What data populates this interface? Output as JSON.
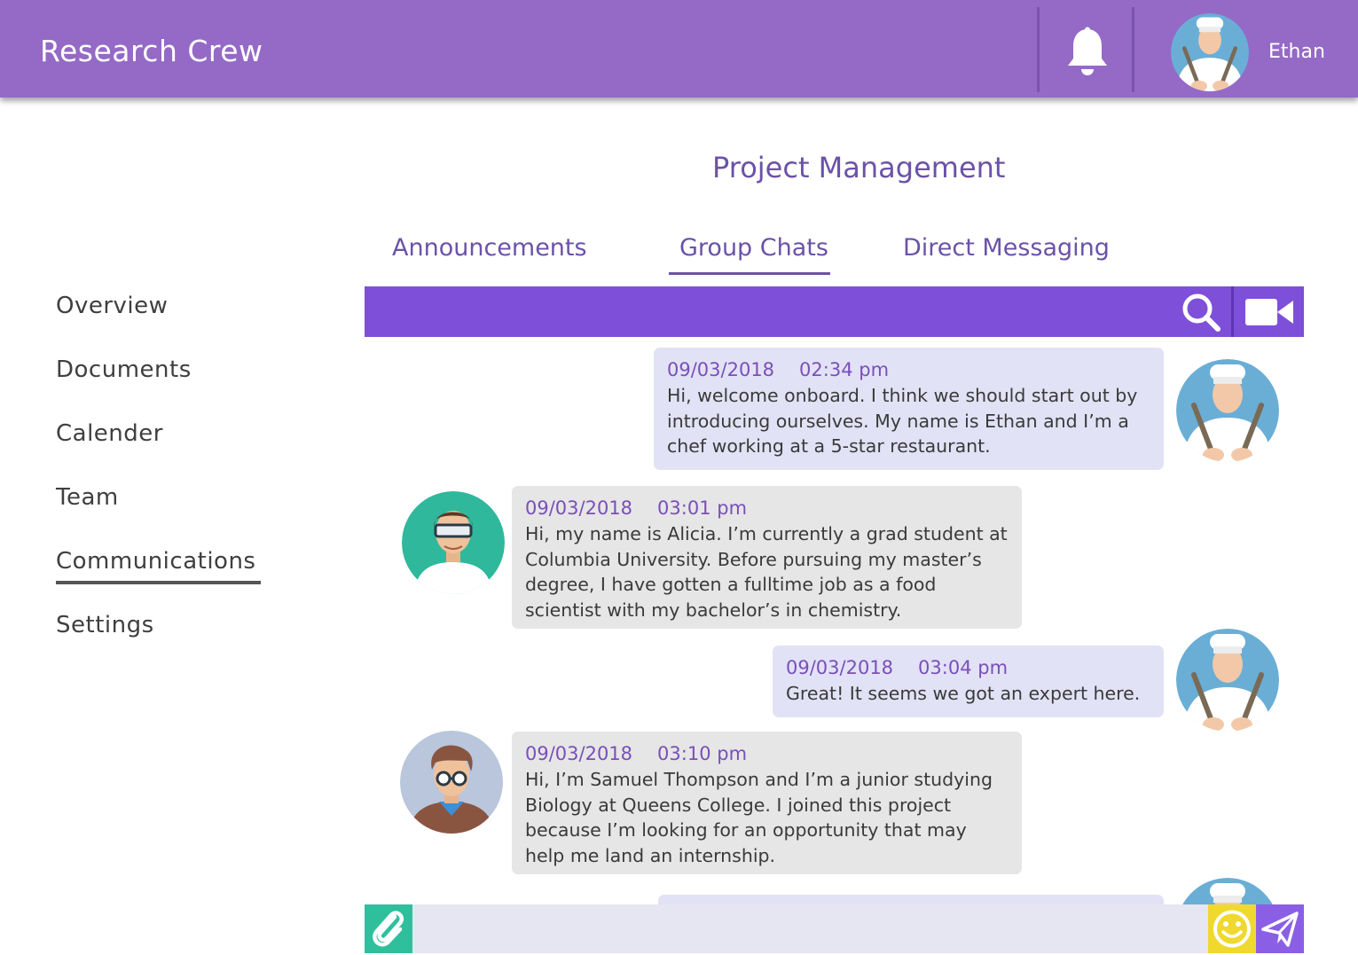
{
  "header": {
    "app_title": "Research Crew",
    "user_name": "Ethan",
    "icons": [
      "bell-icon",
      "user-avatar"
    ]
  },
  "page": {
    "title": "Project Management"
  },
  "tabs": [
    {
      "label": "Announcements"
    },
    {
      "label": "Group Chats",
      "active": true
    },
    {
      "label": "Direct Messaging"
    }
  ],
  "sidebar": {
    "items": [
      {
        "label": "Overview"
      },
      {
        "label": "Documents"
      },
      {
        "label": "Calender"
      },
      {
        "label": "Team"
      },
      {
        "label": "Communications",
        "active": true
      },
      {
        "label": "Settings"
      }
    ]
  },
  "chat_toolbar": {
    "icons": [
      "search-icon",
      "video-camera-icon"
    ]
  },
  "messages": [
    {
      "sender": "Ethan",
      "date": "09/03/2018",
      "time": "02:34 pm",
      "text": "Hi, welcome onboard. I think we should start out by introducing ourselves. My name is Ethan and I’m a chef working at a 5-star restaurant."
    },
    {
      "sender": "Alicia",
      "date": "09/03/2018",
      "time": "03:01 pm",
      "text": "Hi, my name is Alicia. I’m currently a grad student at Columbia University. Before pursuing my master’s degree, I have gotten a fulltime job as a food scientist with my bachelor’s in chemistry."
    },
    {
      "sender": "Ethan",
      "date": "09/03/2018",
      "time": "03:04 pm",
      "text": "Great! It seems we got an expert here."
    },
    {
      "sender": "Samuel",
      "date": "09/03/2018",
      "time": "03:10 pm",
      "text": "Hi, I’m Samuel Thompson and I’m a junior studying Biology at Queens College. I joined this project because I’m looking for an opportunity that may help me land an internship."
    }
  ],
  "composer": {
    "placeholder": "",
    "icons": [
      "paperclip-icon",
      "smiley-icon",
      "paper-plane-icon"
    ]
  },
  "colors": {
    "header": "#946ac6",
    "accent": "#7e4fd8",
    "title": "#6b52a8",
    "own_bubble": "#e2e2f6",
    "other_bubble": "#e6e6e6",
    "attach": "#2fbf9d",
    "emoji": "#efd92e",
    "send": "#8a5fe6"
  }
}
